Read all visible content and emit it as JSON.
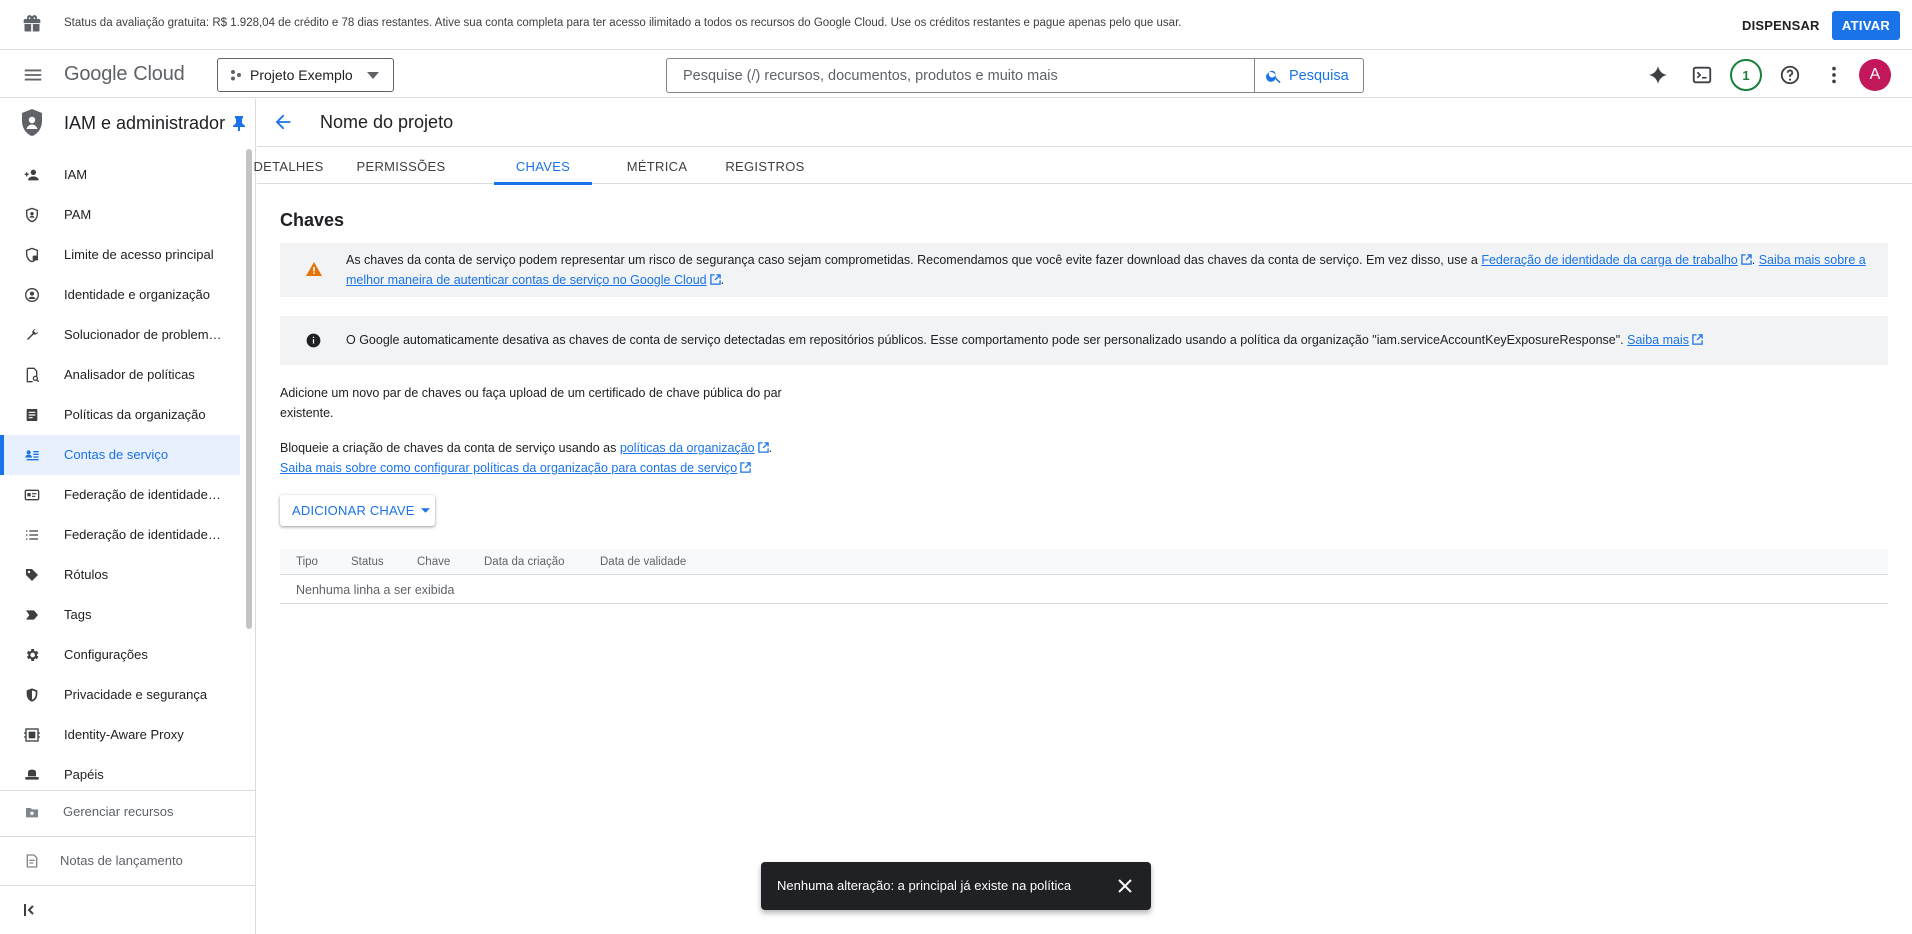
{
  "banner": {
    "text": "Status da avaliação gratuita: R$ 1.928,04 de crédito e 78 dias restantes. Ative sua conta completa para ter acesso ilimitado a todos os recursos do Google Cloud. Use os créditos restantes e pague apenas pelo que usar.",
    "dismiss_label": "DISPENSAR",
    "activate_label": "ATIVAR",
    "icon": "gift-icon"
  },
  "header": {
    "logo_word": "Google",
    "logo_product": "Cloud",
    "project_name": "Projeto Exemplo",
    "search_placeholder": "Pesquise (/) recursos, documentos, produtos e muito mais",
    "search_label": "Pesquisa",
    "notification_count": "1",
    "avatar_letter": "A"
  },
  "sidebar": {
    "title": "IAM e administrador",
    "items": [
      {
        "label": "IAM",
        "icon": "person-add-icon"
      },
      {
        "label": "PAM",
        "icon": "shield-check-icon"
      },
      {
        "label": "Limite de acesso principal",
        "icon": "shield-lock-icon"
      },
      {
        "label": "Identidade e organização",
        "icon": "account-circle-icon"
      },
      {
        "label": "Solucionador de problemas de políticas",
        "icon": "wrench-icon"
      },
      {
        "label": "Analisador de políticas",
        "icon": "document-search-icon"
      },
      {
        "label": "Políticas da organização",
        "icon": "policy-document-icon"
      },
      {
        "label": "Contas de serviço",
        "icon": "service-account-icon"
      },
      {
        "label": "Federação de identidade da carga de trabalho",
        "icon": "id-card-icon"
      },
      {
        "label": "Federação de identidade da força de trabalho",
        "icon": "list-icon"
      },
      {
        "label": "Rótulos",
        "icon": "label-icon"
      },
      {
        "label": "Tags",
        "icon": "tag-arrow-icon"
      },
      {
        "label": "Configurações",
        "icon": "gear-icon"
      },
      {
        "label": "Privacidade e segurança",
        "icon": "security-shield-icon"
      },
      {
        "label": "Identity-Aware Proxy",
        "icon": "proxy-icon"
      },
      {
        "label": "Papéis",
        "icon": "hat-icon"
      }
    ],
    "active_index": 7,
    "manage_resources": "Gerenciar recursos",
    "release_notes": "Notas de lançamento"
  },
  "main": {
    "title": "Nome do projeto",
    "tabs": [
      {
        "label": "DETALHES"
      },
      {
        "label": "PERMISSÕES"
      },
      {
        "label": "CHAVES"
      },
      {
        "label": "MÉTRICA"
      },
      {
        "label": "REGISTROS"
      }
    ],
    "active_tab": 2,
    "section_title": "Chaves",
    "warning": {
      "text": "As chaves da conta de serviço podem representar um risco de segurança caso sejam comprometidas. Recomendamos que você evite fazer download das chaves da conta de serviço. Em vez disso, use a ",
      "link1": "Federação de identidade da carga de trabalho",
      "sep": ". ",
      "link2": "Saiba mais sobre a melhor maneira de autenticar contas de serviço no Google Cloud",
      "end": "."
    },
    "info": {
      "text": "O Google automaticamente desativa as chaves de conta de serviço detectadas em repositórios públicos. Esse comportamento pode ser personalizado usando a política da organização \"iam.serviceAccountKeyExposureResponse\". ",
      "link": "Saiba mais"
    },
    "add_pair_text": "Adicione um novo par de chaves ou faça upload de um certificado de chave pública do par existente.",
    "block_text": "Bloqueie a criação de chaves da conta de serviço usando as ",
    "block_link": "políticas da organização",
    "block_end": ".",
    "learn_link": "Saiba mais sobre como configurar políticas da organização para contas de serviço",
    "add_key_label": "ADICIONAR CHAVE",
    "table": {
      "columns": [
        "Tipo",
        "Status",
        "Chave",
        "Data da criação",
        "Data de validade"
      ],
      "empty_message": "Nenhuma linha a ser exibida"
    }
  },
  "snackbar": {
    "message": "Nenhuma alteração: a principal já existe na política"
  },
  "colors": {
    "accent": "#1a73e8",
    "warning": "#e8710a",
    "success": "#188038",
    "avatar": "#c2185b"
  }
}
